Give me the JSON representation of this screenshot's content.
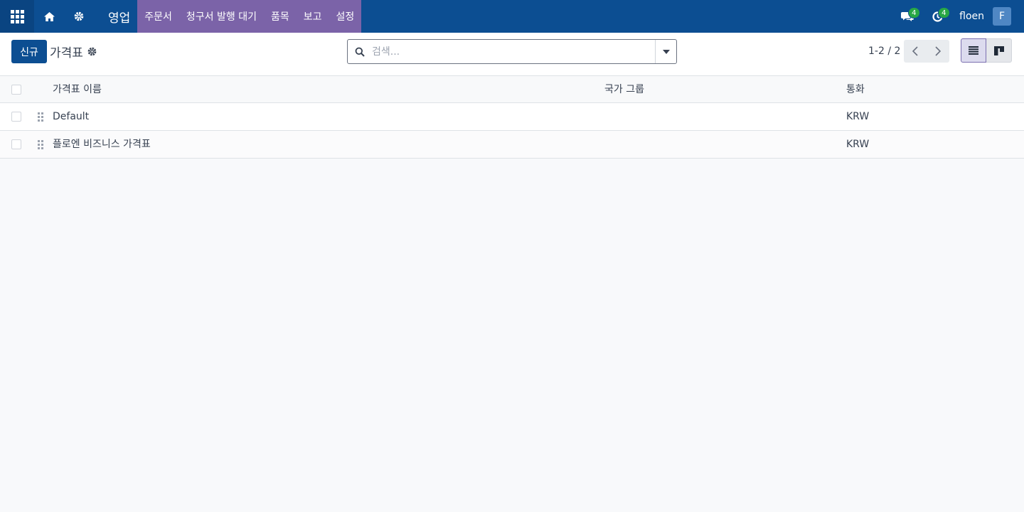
{
  "navbar": {
    "brand": "영업",
    "menu": [
      {
        "label": "주문서"
      },
      {
        "label": "청구서 발행 대기"
      },
      {
        "label": "품목"
      },
      {
        "label": "보고"
      },
      {
        "label": "설정"
      }
    ],
    "messages_badge": "4",
    "activities_badge": "4",
    "username": "floen",
    "avatar_initial": "F",
    "icons": [
      "apps-grid-icon",
      "home-icon",
      "gear-icon",
      "chat-icon",
      "clock-icon"
    ]
  },
  "control_panel": {
    "new_label": "신규",
    "breadcrumb": "가격표",
    "search": {
      "placeholder": "검색...",
      "value": ""
    },
    "pager": "1-2 / 2"
  },
  "table": {
    "headers": {
      "name": "가격표 이름",
      "country_group": "국가 그룹",
      "currency": "통화"
    },
    "rows": [
      {
        "name": "Default",
        "country_group": "",
        "currency": "KRW"
      },
      {
        "name": "플로엔 비즈니스 가격표",
        "country_group": "",
        "currency": "KRW"
      }
    ]
  },
  "colors": {
    "navbar": "#0c4e92",
    "menu_highlight": "#7b63a8",
    "primary_button": "#0c4e92",
    "badge": "#28a745"
  }
}
